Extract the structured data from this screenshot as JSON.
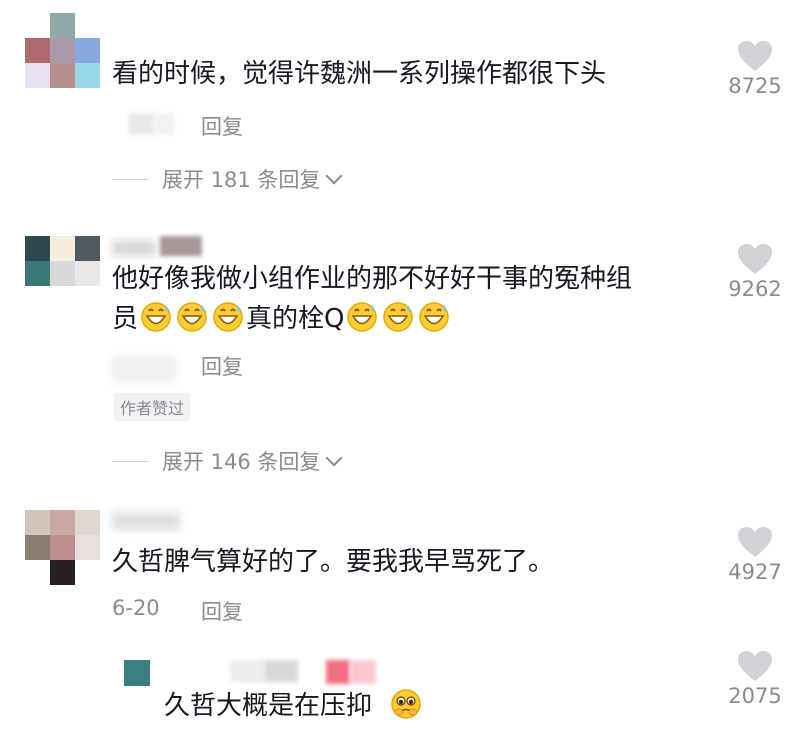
{
  "comments": [
    {
      "text": "看的时候，觉得许魏洲一系列操作都很下头",
      "reply_label": "回复",
      "expand_label": "展开 181 条回复",
      "likes": "8725"
    },
    {
      "text_line1": "他好像我做小组作业的那不好好干事的冤种组",
      "text_line2_a": "员",
      "text_line2_b": "真的栓Q",
      "reply_label": "回复",
      "badge": "作者赞过",
      "expand_label": "展开 146 条回复",
      "likes": "9262"
    },
    {
      "text": "久哲脾气算好的了。要我我早骂死了。",
      "date": "6-20",
      "reply_label": "回复",
      "likes": "4927"
    }
  ],
  "sub_reply": {
    "text": "久哲大概是在压抑",
    "likes": "2075"
  },
  "icons": {
    "like": "heart-icon",
    "expand": "chevron-down-icon",
    "emoji_sweat_smile": "grinning-sweat-emoji",
    "emoji_pleading": "pleading-emoji"
  },
  "colors": {
    "text": "#161823",
    "secondary": "#8a8a8f",
    "heart": "#d2d2d6"
  }
}
